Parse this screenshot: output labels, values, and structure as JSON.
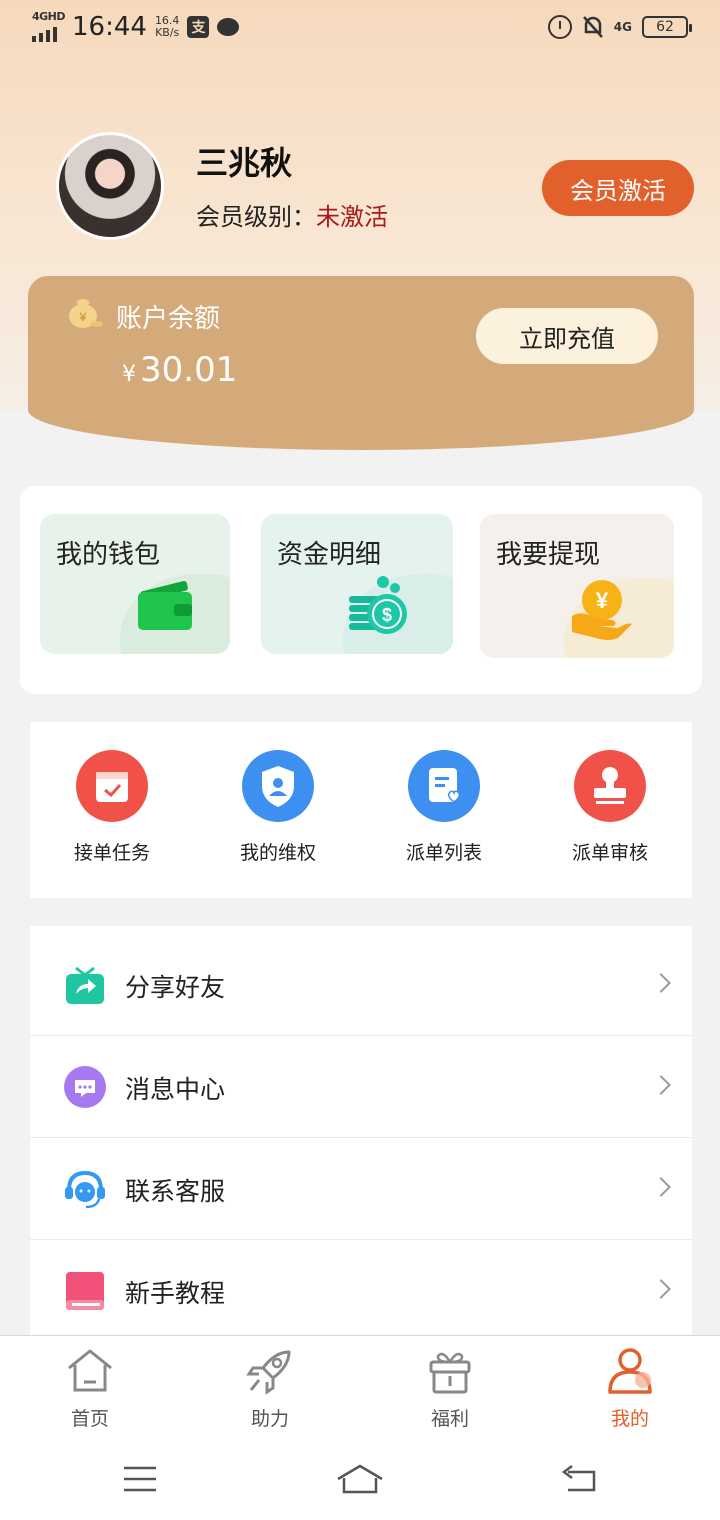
{
  "status_bar": {
    "network_label": "4GHD",
    "time": "16:44",
    "speed_value": "16.4",
    "speed_unit": "KB/s",
    "pay_icon_char": "支",
    "net_right": "4G",
    "battery": "62"
  },
  "profile": {
    "username": "三兆秋",
    "level_label": "会员级别：",
    "level_value": "未激活",
    "activate_button": "会员激活"
  },
  "balance": {
    "label": "账户余额",
    "currency": "¥",
    "amount": "30.01",
    "recharge_button": "立即充值"
  },
  "feature_cards": [
    {
      "label": "我的钱包",
      "icon": "wallet-icon"
    },
    {
      "label": "资金明细",
      "icon": "coins-icon"
    },
    {
      "label": "我要提现",
      "icon": "withdraw-icon"
    }
  ],
  "quick_actions": [
    {
      "label": "接单任务",
      "icon": "calendar-check-icon",
      "color": "#f0524a"
    },
    {
      "label": "我的维权",
      "icon": "shield-user-icon",
      "color": "#3d8ff0"
    },
    {
      "label": "派单列表",
      "icon": "document-heart-icon",
      "color": "#3d8ff0"
    },
    {
      "label": "派单审核",
      "icon": "stamp-icon",
      "color": "#f0524a"
    }
  ],
  "menu": [
    {
      "label": "分享好友",
      "icon": "share-gift-icon"
    },
    {
      "label": "消息中心",
      "icon": "message-icon"
    },
    {
      "label": "联系客服",
      "icon": "headset-icon"
    },
    {
      "label": "新手教程",
      "icon": "book-icon"
    }
  ],
  "tabs": [
    {
      "label": "首页",
      "icon": "home-icon"
    },
    {
      "label": "助力",
      "icon": "rocket-icon"
    },
    {
      "label": "福利",
      "icon": "gift-icon"
    },
    {
      "label": "我的",
      "icon": "user-icon",
      "active": true
    }
  ],
  "colors": {
    "accent": "#e1602c",
    "balance_card": "#d5aa7a",
    "level_inactive": "#a8191c"
  }
}
